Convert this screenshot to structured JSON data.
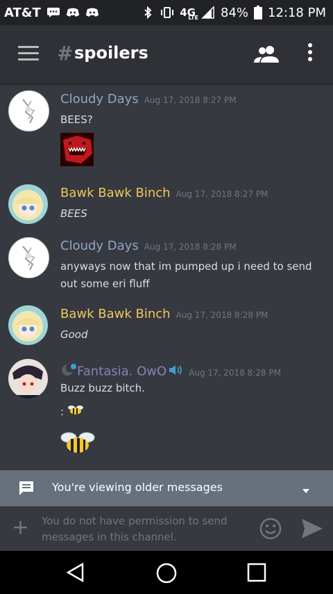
{
  "status_bar": {
    "carrier": "AT&T",
    "network": "4G",
    "network_sub": "LTE",
    "battery": "84%",
    "time": "12:18 PM"
  },
  "header": {
    "hash": "#",
    "channel_name": "spoilers"
  },
  "messages": [
    {
      "username": "Cloudy Days",
      "username_color": "#8ea7c7",
      "timestamp": "Aug 17, 2018 8:27 PM",
      "text": "BEES?",
      "italic": false
    },
    {
      "username": "Bawk Bawk Binch",
      "username_color": "#f0c75a",
      "timestamp": "Aug 17, 2018 8:27 PM",
      "text": "BEES",
      "italic": true
    },
    {
      "username": "Cloudy Days",
      "username_color": "#8ea7c7",
      "timestamp": "Aug 17, 2018 8:28 PM",
      "text": "anyways now that im pumped up i need to send out some eri fluff",
      "italic": false
    },
    {
      "username": "Bawk Bawk Binch",
      "username_color": "#f0c75a",
      "timestamp": "Aug 17, 2018 8:28 PM",
      "text": "Good",
      "italic": true
    },
    {
      "username": "Fantasia. OwO",
      "username_color": "#8d7fb8",
      "timestamp": "Aug 17, 2018 8:28 PM",
      "text": "Buzz buzz bitch.",
      "text2": ":",
      "italic": false
    }
  ],
  "banner": {
    "label": "You're viewing older messages"
  },
  "composer": {
    "plus": "+",
    "placeholder": "You do not have permission to send messages in this channel."
  },
  "colors": {
    "background": "#36393f",
    "appbar": "#2f3136",
    "statusbar": "#202225",
    "banner": "#67707d",
    "timestamp": "#72767d"
  },
  "icons": [
    "menu-icon",
    "members-icon",
    "more-icon",
    "chat-icon",
    "chevron-down-icon",
    "emoji-icon",
    "send-icon",
    "back-icon",
    "home-icon",
    "recents-icon"
  ]
}
